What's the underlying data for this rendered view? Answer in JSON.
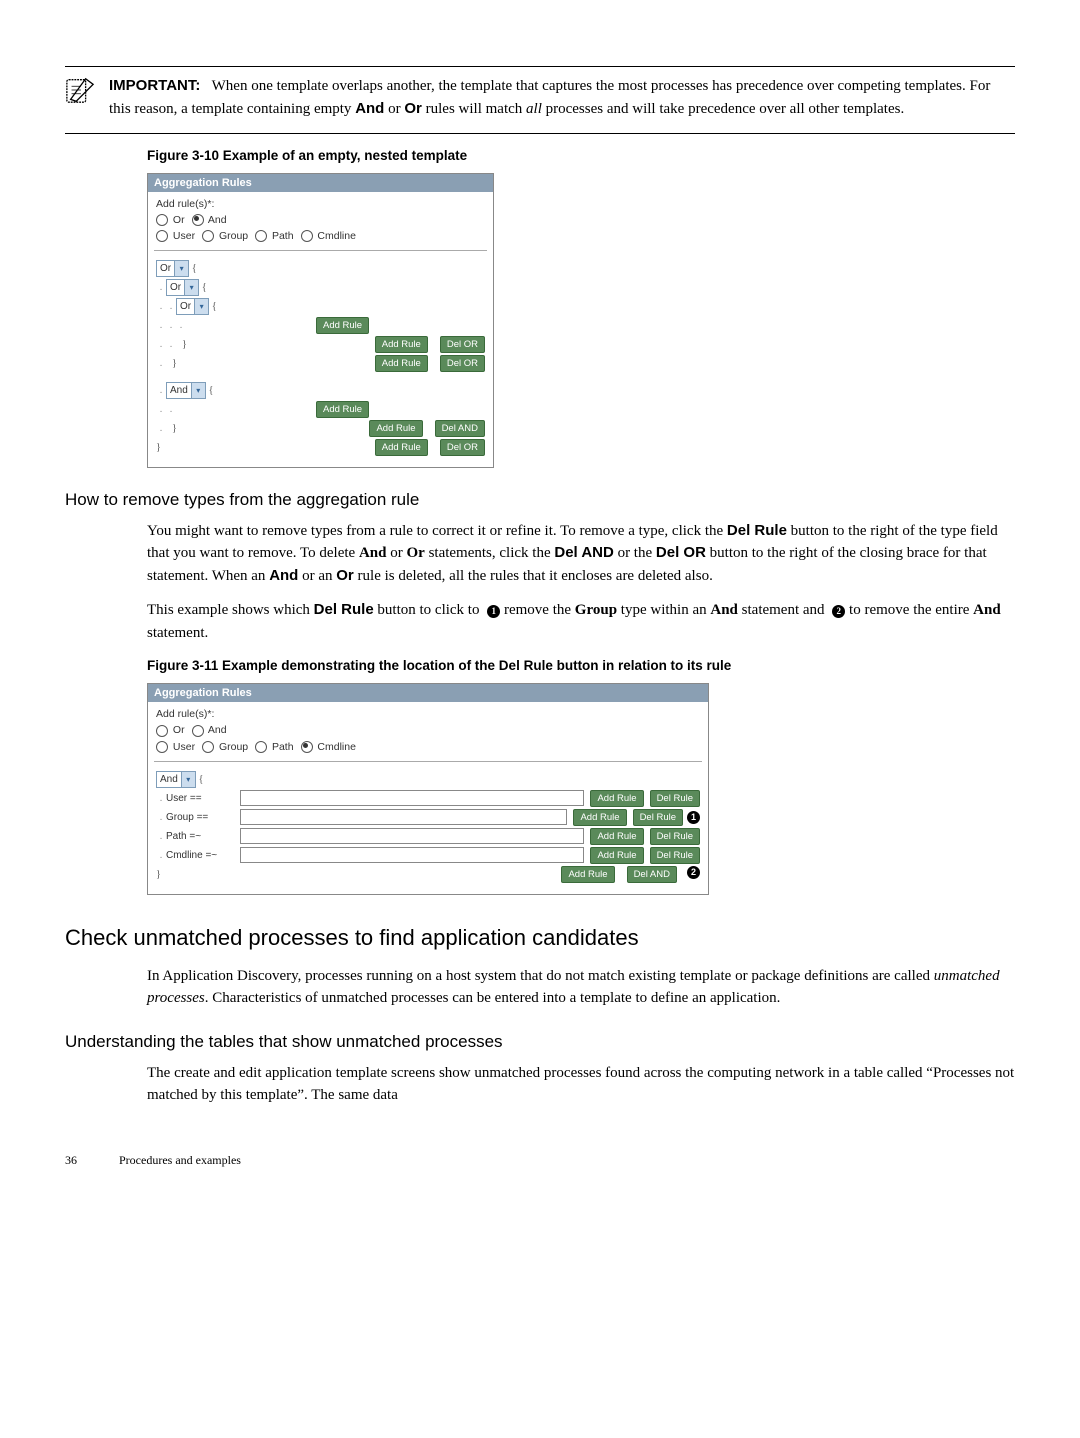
{
  "important": {
    "label": "IMPORTANT:",
    "text_before": "When one template overlaps another, the template that captures the most processes has precedence over competing templates. For this reason, a template containing empty ",
    "and": "And",
    "text_mid": " or ",
    "or": "Or",
    "text_after": " rules will match ",
    "all": "all",
    "text_end": " processes and will take precedence over all other templates."
  },
  "fig1": {
    "caption": "Figure 3-10 Example of an empty, nested template",
    "panel_title": "Aggregation Rules",
    "addrule": "Add rule(s)*:",
    "or": "Or",
    "and": "And",
    "user": "User",
    "group": "Group",
    "path": "Path",
    "cmdline": "Cmdline",
    "btn_add": "Add Rule",
    "btn_delor": "Del OR",
    "btn_deland": "Del AND"
  },
  "sec1": {
    "heading": "How to remove types from the aggregation rule",
    "p1a": "You might want to remove types from a rule to correct it or refine it. To remove a type, click the ",
    "delrule": "Del Rule",
    "p1b": " button to the right of the type field that you want to remove. To delete ",
    "and": "And",
    "or_word": " or ",
    "or": "Or",
    "p1c": " statements, click the ",
    "deland": "Del AND",
    "p1d": " or the ",
    "delor": "Del OR",
    "p1e": " button to the right of the closing brace for that statement. When an ",
    "and2": "And",
    "p1f": " or an ",
    "or2": "Or",
    "p1g": " rule is deleted, all the rules that it encloses are deleted also.",
    "p2a": "This example shows which ",
    "p2b": " button to click to ",
    "p2c": " remove the ",
    "group": "Group",
    "p2d": " type within an ",
    "and3": "And",
    "p2e": " statement and ",
    "p2f": " to remove the entire ",
    "and4": "And",
    "p2g": "  statement."
  },
  "fig2": {
    "caption": "Figure 3-11 Example demonstrating the location of the Del Rule button in relation to its rule",
    "panel_title": "Aggregation Rules",
    "addrule": "Add rule(s)*:",
    "or": "Or",
    "and": "And",
    "user": "User",
    "group": "Group",
    "path": "Path",
    "cmdline": "Cmdline",
    "btn_add": "Add Rule",
    "btn_delrule": "Del Rule",
    "btn_deland": "Del AND",
    "row_user": "User ==",
    "row_group": "Group ==",
    "row_path": "Path =~",
    "row_cmd": "Cmdline =~"
  },
  "sec2": {
    "heading": "Check unmatched processes to find application candidates",
    "p1a": "In Application Discovery, processes running on a host system that do not match existing template or package definitions are called ",
    "unm": "unmatched processes",
    "p1b": ". Characteristics of unmatched processes can be entered into a template to define an application."
  },
  "sec3": {
    "heading": "Understanding the tables that show unmatched processes",
    "p1": "The create and edit application template screens show unmatched processes found across the computing network in a table called “Processes not matched by this template”. The same data"
  },
  "footer": {
    "page": "36",
    "chapter": "Procedures and examples"
  },
  "badges": {
    "one": "1",
    "two": "2"
  }
}
